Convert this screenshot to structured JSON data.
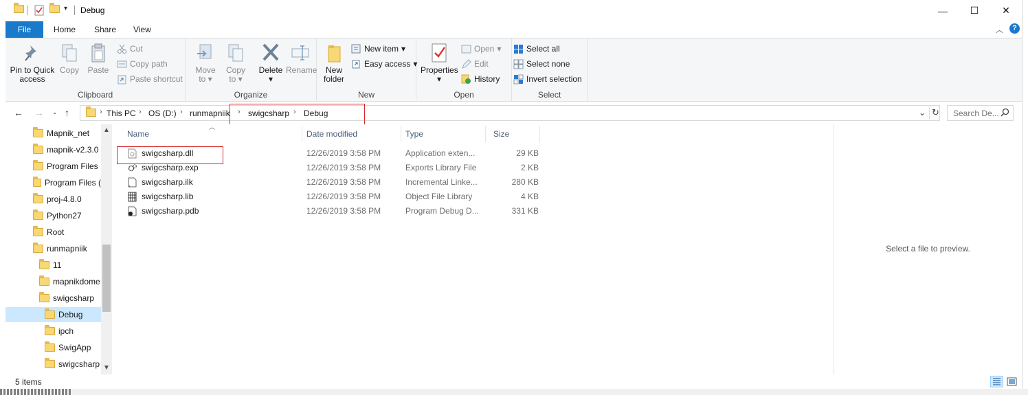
{
  "window": {
    "title": "Debug",
    "controls": {
      "minimize": "—",
      "maximize": "☐",
      "close": "✕"
    }
  },
  "ribbon_tabs": {
    "file": "File",
    "home": "Home",
    "share": "Share",
    "view": "View"
  },
  "ribbon": {
    "clipboard": {
      "label": "Clipboard",
      "pin_line1": "Pin to Quick",
      "pin_line2": "access",
      "copy": "Copy",
      "paste": "Paste",
      "cut": "Cut",
      "copy_path": "Copy path",
      "paste_shortcut": "Paste shortcut"
    },
    "organize": {
      "label": "Organize",
      "move_to_line1": "Move",
      "move_to_line2": "to",
      "copy_to_line1": "Copy",
      "copy_to_line2": "to",
      "delete": "Delete",
      "rename": "Rename"
    },
    "new": {
      "label": "New",
      "new_folder_line1": "New",
      "new_folder_line2": "folder",
      "new_item": "New item",
      "easy_access": "Easy access"
    },
    "open": {
      "label": "Open",
      "properties": "Properties",
      "open": "Open",
      "edit": "Edit",
      "history": "History"
    },
    "select": {
      "label": "Select",
      "select_all": "Select all",
      "select_none": "Select none",
      "invert_selection": "Invert selection"
    }
  },
  "address": {
    "crumbs": [
      "This PC",
      "OS (D:)",
      "runmapniik",
      "swigcsharp",
      "Debug"
    ],
    "search_placeholder": "Search De..."
  },
  "nav": {
    "items": [
      {
        "label": "Mapnik_net"
      },
      {
        "label": "mapnik-v2.3.0"
      },
      {
        "label": "Program Files"
      },
      {
        "label": "Program Files ("
      },
      {
        "label": "proj-4.8.0"
      },
      {
        "label": "Python27"
      },
      {
        "label": "Root"
      },
      {
        "label": "runmapniik"
      },
      {
        "label": "11"
      },
      {
        "label": "mapnikdome"
      },
      {
        "label": "swigcsharp"
      },
      {
        "label": "Debug"
      },
      {
        "label": "ipch"
      },
      {
        "label": "SwigApp"
      },
      {
        "label": "swigcsharp"
      }
    ]
  },
  "columns": {
    "name": "Name",
    "date_modified": "Date modified",
    "type": "Type",
    "size": "Size"
  },
  "files": [
    {
      "name": "swigcsharp.dll",
      "date": "12/26/2019 3:58 PM",
      "type": "Application exten...",
      "size": "29 KB",
      "icon": "dll-file-icon"
    },
    {
      "name": "swigcsharp.exp",
      "date": "12/26/2019 3:58 PM",
      "type": "Exports Library File",
      "size": "2 KB",
      "icon": "exp-file-icon"
    },
    {
      "name": "swigcsharp.ilk",
      "date": "12/26/2019 3:58 PM",
      "type": "Incremental Linke...",
      "size": "280 KB",
      "icon": "ilk-file-icon"
    },
    {
      "name": "swigcsharp.lib",
      "date": "12/26/2019 3:58 PM",
      "type": "Object File Library",
      "size": "4 KB",
      "icon": "lib-file-icon"
    },
    {
      "name": "swigcsharp.pdb",
      "date": "12/26/2019 3:58 PM",
      "type": "Program Debug D...",
      "size": "331 KB",
      "icon": "pdb-file-icon"
    }
  ],
  "preview": {
    "text": "Select a file to preview."
  },
  "status": {
    "items_count": "5 items"
  },
  "colors": {
    "accent": "#1979ca",
    "selected": "#cce8ff",
    "highlight_box": "#d62929"
  }
}
